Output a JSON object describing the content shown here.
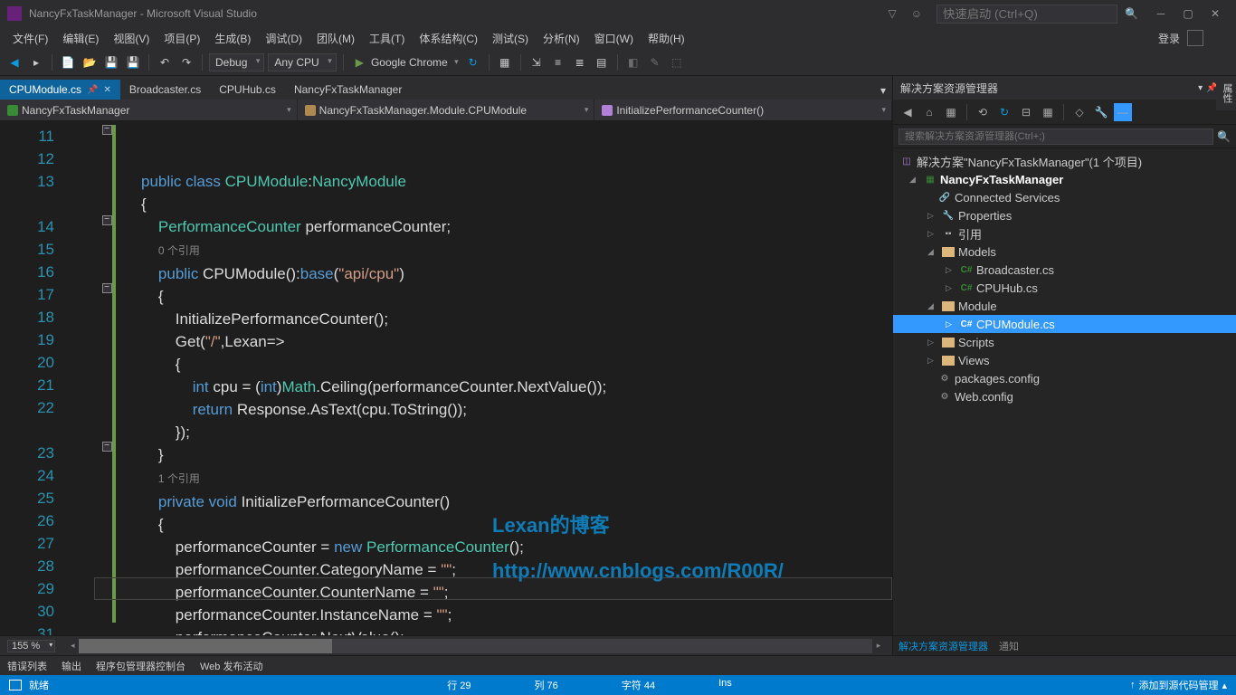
{
  "titlebar": {
    "title": "NancyFxTaskManager - Microsoft Visual Studio",
    "search_placeholder": "快速启动 (Ctrl+Q)"
  },
  "menu": [
    "文件(F)",
    "编辑(E)",
    "视图(V)",
    "项目(P)",
    "生成(B)",
    "调试(D)",
    "团队(M)",
    "工具(T)",
    "体系结构(C)",
    "测试(S)",
    "分析(N)",
    "窗口(W)",
    "帮助(H)"
  ],
  "login": "登录",
  "toolbar": {
    "config": "Debug",
    "platform": "Any CPU",
    "run": "Google Chrome"
  },
  "tabs": [
    {
      "label": "CPUModule.cs",
      "active": true,
      "pinned": true
    },
    {
      "label": "Broadcaster.cs",
      "active": false
    },
    {
      "label": "CPUHub.cs",
      "active": false
    },
    {
      "label": "NancyFxTaskManager",
      "active": false
    }
  ],
  "navbar": {
    "project": "NancyFxTaskManager",
    "class": "NancyFxTaskManager.Module.CPUModule",
    "method": "InitializePerformanceCounter()"
  },
  "code": {
    "lines": [
      "11",
      "12",
      "13",
      "",
      "14",
      "15",
      "16",
      "17",
      "18",
      "19",
      "20",
      "21",
      "22",
      "",
      "23",
      "24",
      "25",
      "26",
      "27",
      "28",
      "29",
      "30",
      "31"
    ],
    "ref0": "0 个引用",
    "ref1": "1 个引用"
  },
  "zoom": "155 %",
  "watermark": {
    "l1": "Lexan的博客",
    "l2": "http://www.cnblogs.com/R00R/"
  },
  "solution": {
    "title": "解决方案资源管理器",
    "search_placeholder": "搜索解决方案资源管理器(Ctrl+;)",
    "root": "解决方案\"NancyFxTaskManager\"(1 个项目)",
    "project": "NancyFxTaskManager",
    "nodes": {
      "connected": "Connected Services",
      "properties": "Properties",
      "refs": "引用",
      "models": "Models",
      "broadcaster": "Broadcaster.cs",
      "cpuhub": "CPUHub.cs",
      "module": "Module",
      "cpumodule": "CPUModule.cs",
      "scripts": "Scripts",
      "views": "Views",
      "packages": "packages.config",
      "webconfig": "Web.config"
    },
    "tabs": {
      "explorer": "解决方案资源管理器",
      "notify": "通知"
    }
  },
  "side_tab": "属性",
  "bottom": {
    "errors": "错误列表",
    "output": "输出",
    "pmc": "程序包管理器控制台",
    "publish": "Web 发布活动"
  },
  "status": {
    "ready": "就绪",
    "line": "行 29",
    "col": "列 76",
    "char": "字符 44",
    "ins": "Ins",
    "source": "添加到源代码管理"
  }
}
